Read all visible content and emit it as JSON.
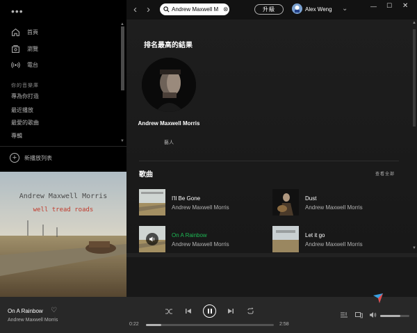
{
  "window": {
    "min": "—",
    "max": "☐",
    "close": "✕"
  },
  "topbar": {
    "back": "‹",
    "forward": "›",
    "search_value": "Andrew Maxwell M",
    "search_clear": "⊗",
    "upgrade_label": "升級",
    "user_name": "Alex Weng",
    "user_chevron": "⌄"
  },
  "sidebar": {
    "menu": "•••",
    "nav": [
      {
        "label": "首頁",
        "icon": "home-icon"
      },
      {
        "label": "瀏覽",
        "icon": "browse-icon"
      },
      {
        "label": "電台",
        "icon": "radio-icon"
      }
    ],
    "library_title": "你的音樂庫",
    "library": [
      "專為你打造",
      "最近播放",
      "最愛的歌曲",
      "專輯"
    ],
    "new_playlist": "新播放列表",
    "scroll_up": "▲",
    "scroll_down": "▼",
    "album_art": {
      "artist": "Andrew Maxwell Morris",
      "title": "well tread roads"
    }
  },
  "main": {
    "top_result_title": "排名最高的結果",
    "artist_name": "Andrew Maxwell Morris",
    "artist_type": "藝人",
    "songs_title": "歌曲",
    "see_all": "查看全部",
    "songs": [
      {
        "title": "I'll Be Gone",
        "artist": "Andrew Maxwell Morris",
        "active": false
      },
      {
        "title": "Dust",
        "artist": "Andrew Maxwell Morris",
        "active": false
      },
      {
        "title": "On A Rainbow",
        "artist": "Andrew Maxwell Morris",
        "active": true
      },
      {
        "title": "Let it go",
        "artist": "Andrew Maxwell Morris",
        "active": false
      }
    ]
  },
  "player": {
    "title": "On A Rainbow",
    "artist": "Andrew Maxwell Morris",
    "heart": "♡",
    "elapsed": "0:22",
    "duration": "2:58",
    "progress": 0.12,
    "volume": 0.7
  },
  "colors": {
    "accent": "#1db954",
    "background": "#121212",
    "sidebar": "#000000",
    "player": "#282828"
  }
}
